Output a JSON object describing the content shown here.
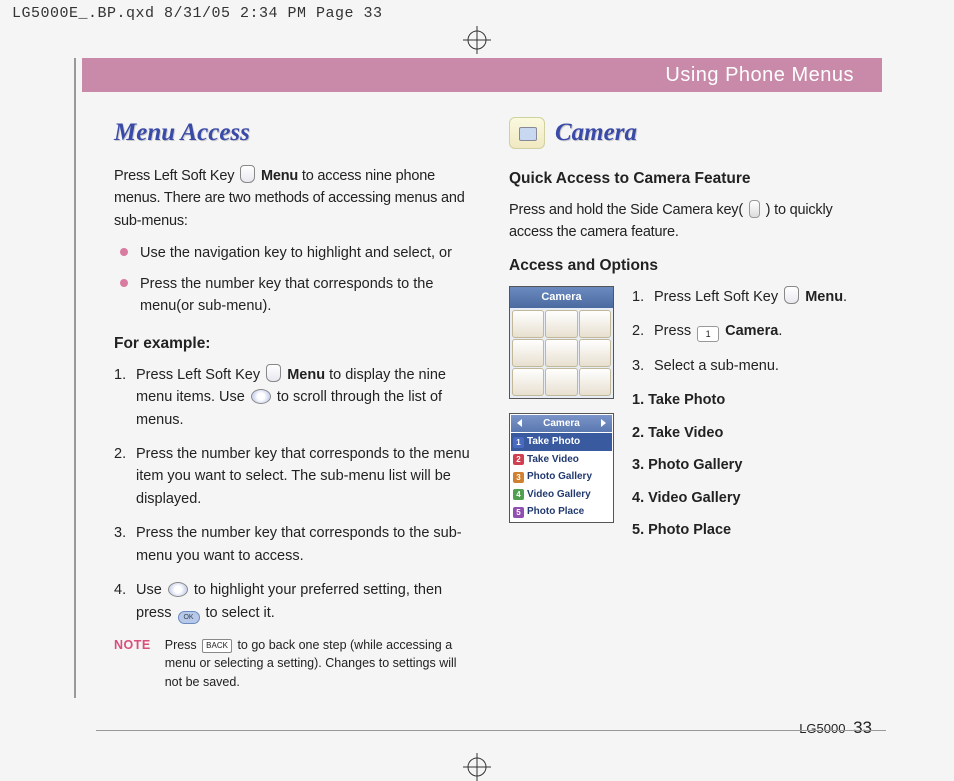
{
  "headerStrip": "LG5000E_.BP.qxd  8/31/05  2:34 PM  Page 33",
  "titleBar": "Using Phone Menus",
  "left": {
    "heading": "Menu Access",
    "intro1a": "Press Left Soft Key ",
    "intro1b": "Menu",
    "intro1c": " to access nine phone menus. There are two methods of accessing menus and sub-menus:",
    "bullet1": "Use the navigation key to highlight and select, or",
    "bullet2": "Press the number key that corresponds to the menu(or sub-menu).",
    "example": "For example:",
    "s1a": "Press Left Soft Key ",
    "s1b": "Menu",
    "s1c": " to display the nine menu items. Use ",
    "s1d": " to scroll through the list of menus.",
    "s2": "Press the number key that corresponds to the menu item you want to select. The sub-menu list will be displayed.",
    "s3": "Press the number key that corresponds to the sub-menu you want to access.",
    "s4a": "Use ",
    "s4b": " to highlight your preferred setting, then press ",
    "s4c": " to select it.",
    "noteLabel": "NOTE",
    "noteA": "Press ",
    "noteB": " to go back one step (while accessing a menu or selecting a setting). Changes to settings will not be saved.",
    "backKey": "BACK"
  },
  "right": {
    "heading": "Camera",
    "quickHead": "Quick Access to Camera Feature",
    "quickA": "Press and hold the Side Camera key( ",
    "quickB": " ) to quickly access the camera feature.",
    "accessHead": "Access and Options",
    "r1a": "Press Left Soft Key ",
    "r1b": "Menu",
    "r1c": ".",
    "r2a": "Press ",
    "r2b": "Camera",
    "r2c": ".",
    "numkey": "1",
    "r3": "Select a sub-menu.",
    "shotTitle": "Camera",
    "listTitle": "Camera",
    "list": [
      "Take Photo",
      "Take Video",
      "Photo Gallery",
      "Video Gallery",
      "Photo Place"
    ],
    "submenu": [
      "1. Take Photo",
      "2. Take Video",
      "3. Photo Gallery",
      "4. Video Gallery",
      "5. Photo Place"
    ]
  },
  "footer": {
    "model": "LG5000",
    "page": "33"
  },
  "okLabel": "OK"
}
